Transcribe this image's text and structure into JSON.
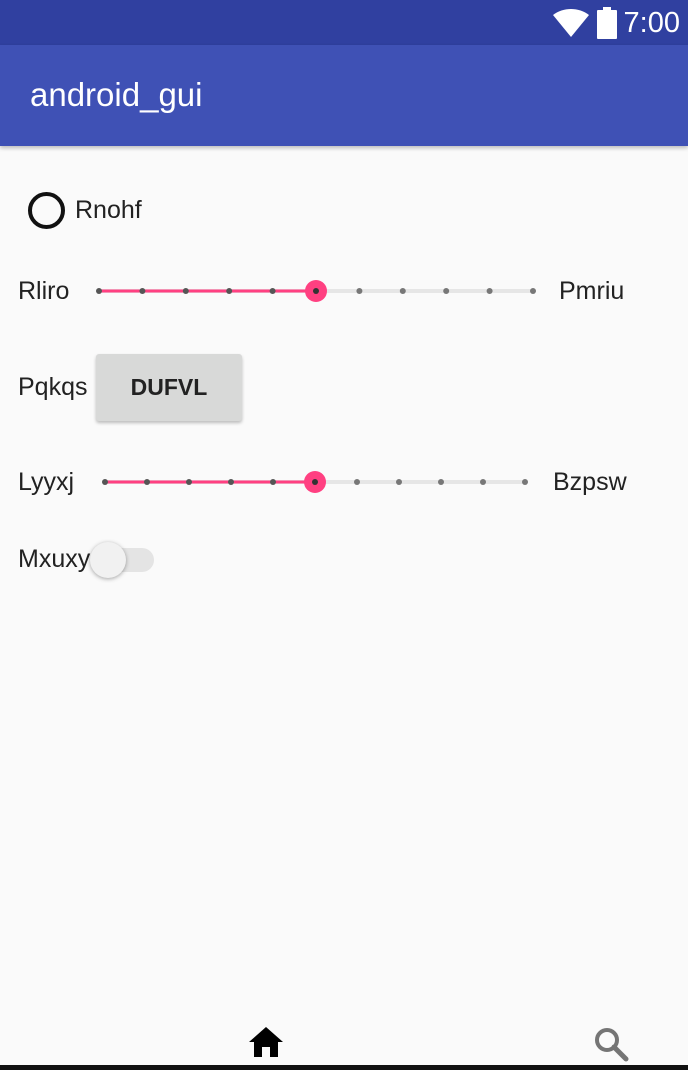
{
  "status_bar": {
    "time": "7:00",
    "icons": [
      "wifi-icon",
      "battery-icon"
    ]
  },
  "app_bar": {
    "title": "android_gui"
  },
  "radio": {
    "label": "Rnohf",
    "checked": false
  },
  "slider1": {
    "left_label": "Rliro",
    "right_label": "Pmriu",
    "steps": 10,
    "value": 5
  },
  "button_row": {
    "label": "Pqkqs",
    "button_text": "DUFVL"
  },
  "slider2": {
    "left_label": "Lyyxj",
    "right_label": "Bzpsw",
    "steps": 10,
    "value": 5
  },
  "switch_row": {
    "label": "Mxuxy",
    "on": false
  },
  "nav": {
    "icons": [
      "home-icon",
      "search-icon"
    ]
  },
  "colors": {
    "primary": "#3f51b5",
    "primary_dark": "#3040a0",
    "accent": "#ff4081"
  }
}
